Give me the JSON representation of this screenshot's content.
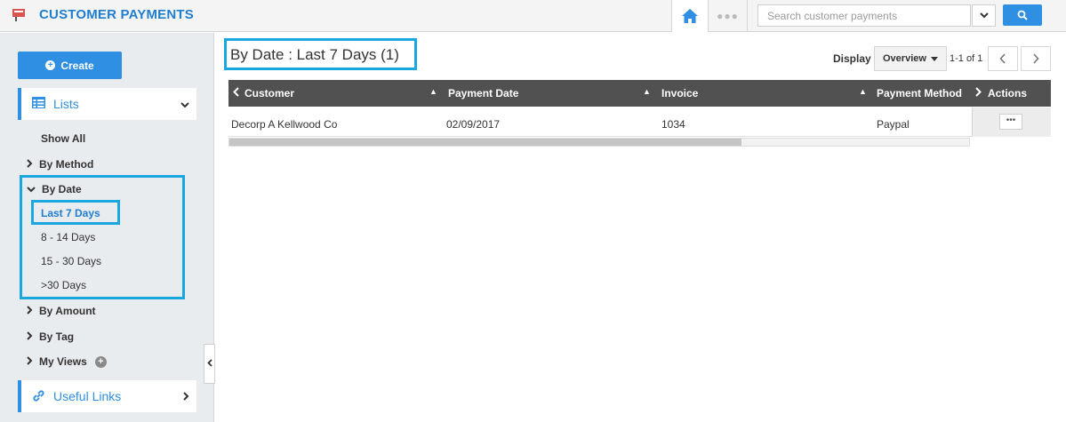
{
  "header": {
    "title": "CUSTOMER PAYMENTS",
    "search_placeholder": "Search customer payments"
  },
  "sidebar": {
    "create_label": "Create",
    "lists_label": "Lists",
    "show_all": "Show All",
    "by_method": "By Method",
    "by_date": "By Date",
    "date_items": [
      "Last 7 Days",
      "8 - 14 Days",
      "15 - 30 Days",
      ">30 Days"
    ],
    "by_amount": "By Amount",
    "by_tag": "By Tag",
    "my_views": "My Views",
    "useful_links": "Useful Links"
  },
  "main": {
    "title": "By Date : Last 7 Days (1)",
    "display_label": "Display",
    "display_value": "Overview",
    "pager": "1-1 of 1"
  },
  "table": {
    "columns": [
      "Customer",
      "Payment Date",
      "Invoice",
      "Payment Method",
      "Actions"
    ],
    "rows": [
      {
        "customer": "Decorp A Kellwood Co",
        "payment_date": "02/09/2017",
        "invoice": "1034",
        "payment_method": "Paypal"
      }
    ]
  },
  "colors": {
    "accent": "#2f8fe3",
    "highlight": "#1aa7e0",
    "table_header": "#515151"
  },
  "icons": [
    "app-logo-icon",
    "home-icon",
    "more-dots-icon",
    "chevron-down-icon",
    "search-icon",
    "plus-circle-icon",
    "list-icon",
    "link-icon",
    "chevron-right-icon",
    "chevron-left-icon"
  ]
}
